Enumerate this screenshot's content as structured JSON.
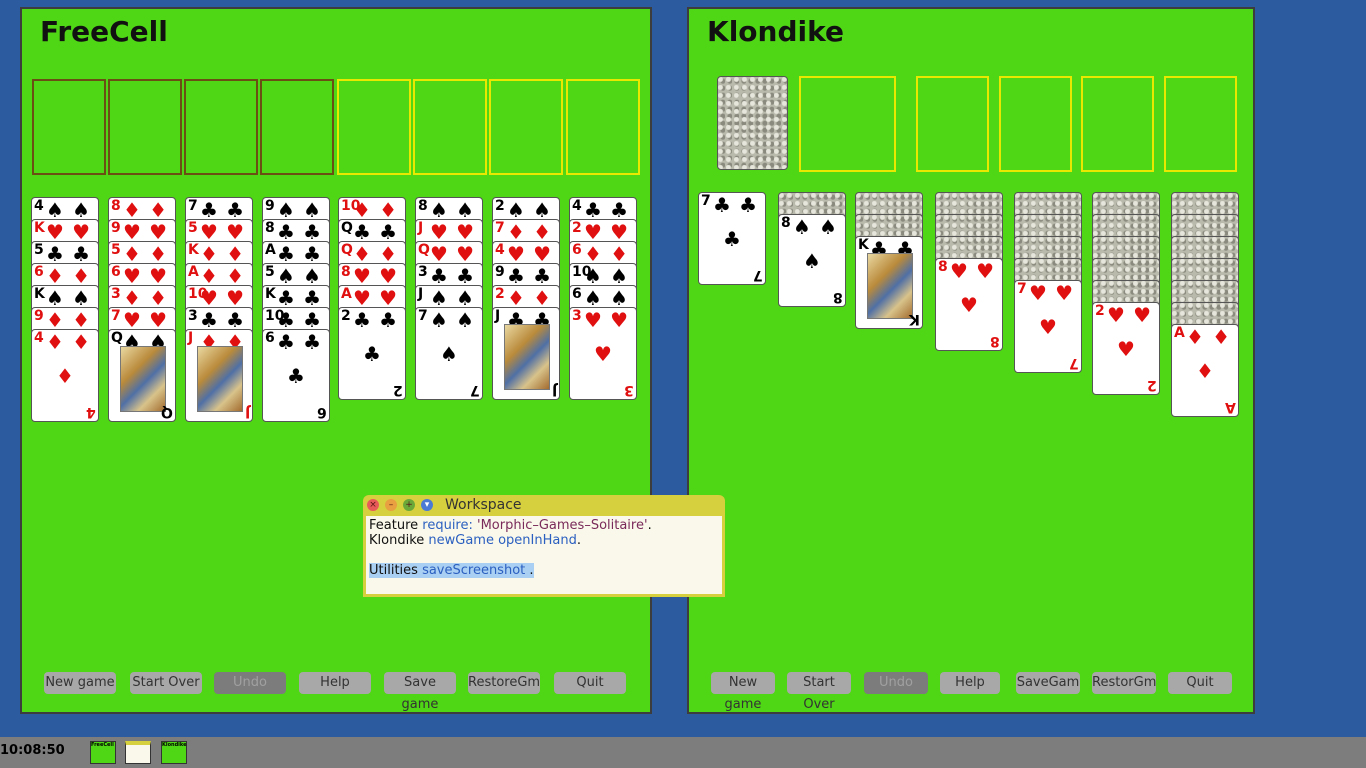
{
  "freecell": {
    "title": "FreeCell",
    "buttons": [
      "New game",
      "Start Over",
      "Undo",
      "Help",
      "Save game",
      "RestoreGm",
      "Quit"
    ],
    "columns": [
      [
        [
          "4",
          "♠",
          "b"
        ],
        [
          "K",
          "♥",
          "r"
        ],
        [
          "5",
          "♣",
          "b"
        ],
        [
          "6",
          "♦",
          "r"
        ],
        [
          "K",
          "♠",
          "b"
        ],
        [
          "9",
          "♦",
          "r"
        ],
        [
          "4",
          "♦",
          "r"
        ]
      ],
      [
        [
          "8",
          "♦",
          "r"
        ],
        [
          "9",
          "♥",
          "r"
        ],
        [
          "5",
          "♦",
          "r"
        ],
        [
          "6",
          "♥",
          "r"
        ],
        [
          "3",
          "♦",
          "r"
        ],
        [
          "7",
          "♥",
          "r"
        ],
        [
          "Q",
          "♠",
          "b"
        ]
      ],
      [
        [
          "7",
          "♣",
          "b"
        ],
        [
          "5",
          "♥",
          "r"
        ],
        [
          "K",
          "♦",
          "r"
        ],
        [
          "A",
          "♦",
          "r"
        ],
        [
          "10",
          "♥",
          "r"
        ],
        [
          "3",
          "♣",
          "b"
        ],
        [
          "J",
          "♦",
          "r"
        ]
      ],
      [
        [
          "9",
          "♠",
          "b"
        ],
        [
          "8",
          "♣",
          "b"
        ],
        [
          "A",
          "♣",
          "b"
        ],
        [
          "5",
          "♠",
          "b"
        ],
        [
          "K",
          "♣",
          "b"
        ],
        [
          "10",
          "♣",
          "b"
        ],
        [
          "6",
          "♣",
          "b"
        ]
      ],
      [
        [
          "10",
          "♦",
          "r"
        ],
        [
          "Q",
          "♣",
          "b"
        ],
        [
          "Q",
          "♦",
          "r"
        ],
        [
          "8",
          "♥",
          "r"
        ],
        [
          "A",
          "♥",
          "r"
        ],
        [
          "2",
          "♣",
          "b"
        ]
      ],
      [
        [
          "8",
          "♠",
          "b"
        ],
        [
          "J",
          "♥",
          "r"
        ],
        [
          "Q",
          "♥",
          "r"
        ],
        [
          "3",
          "♣",
          "b"
        ],
        [
          "J",
          "♠",
          "b"
        ],
        [
          "7",
          "♠",
          "b"
        ]
      ],
      [
        [
          "2",
          "♠",
          "b"
        ],
        [
          "7",
          "♦",
          "r"
        ],
        [
          "4",
          "♥",
          "r"
        ],
        [
          "9",
          "♣",
          "b"
        ],
        [
          "2",
          "♦",
          "r"
        ],
        [
          "J",
          "♣",
          "b"
        ]
      ],
      [
        [
          "4",
          "♣",
          "b"
        ],
        [
          "2",
          "♥",
          "r"
        ],
        [
          "6",
          "♦",
          "r"
        ],
        [
          "10",
          "♠",
          "b"
        ],
        [
          "6",
          "♠",
          "b"
        ],
        [
          "3",
          "♥",
          "r"
        ]
      ]
    ]
  },
  "klondike": {
    "title": "Klondike",
    "buttons": [
      "New game",
      "Start Over",
      "Undo",
      "Help",
      "SaveGam",
      "RestorGm",
      "Quit"
    ],
    "columns": [
      {
        "hidden": 0,
        "card": [
          "7",
          "♣",
          "b"
        ]
      },
      {
        "hidden": 1,
        "card": [
          "8",
          "♠",
          "b"
        ]
      },
      {
        "hidden": 2,
        "card": [
          "K",
          "♣",
          "b"
        ]
      },
      {
        "hidden": 3,
        "card": [
          "8",
          "♥",
          "r"
        ]
      },
      {
        "hidden": 4,
        "card": [
          "7",
          "♥",
          "r"
        ]
      },
      {
        "hidden": 5,
        "card": [
          "2",
          "♥",
          "r"
        ]
      },
      {
        "hidden": 6,
        "card": [
          "A",
          "♦",
          "r"
        ]
      }
    ]
  },
  "workspace": {
    "title": "Workspace",
    "line1": [
      "Feature ",
      "require: ",
      "'Morphic–Games–Solitaire'",
      "."
    ],
    "line2": [
      "Klondike ",
      "newGame openInHand",
      "."
    ],
    "line3": [
      "Utilities ",
      "saveScreenshot ",
      "."
    ]
  },
  "taskbar": {
    "clock": "10:08:50",
    "thumbs": [
      "FreeCell",
      "",
      "Klondike"
    ]
  }
}
